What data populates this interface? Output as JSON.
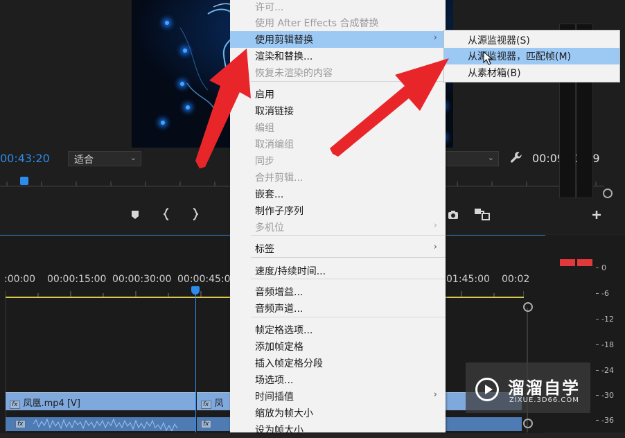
{
  "monitor": {
    "timecode_current": "00:43:20",
    "timecode_duration": "00:09:02:19",
    "fit_value": "适合",
    "playhead_position": 0.04
  },
  "timeline": {
    "ruler_labels": [
      ":00:00",
      "00:00:15:00",
      "00:00:30:00",
      "00:00:45:00",
      "01:45:00",
      "00:02"
    ],
    "clip_1_name": "凤凰.mp4 [V]",
    "clip_2_name": "凤",
    "fx_label": "fx"
  },
  "meters": {
    "db_labels": [
      "0",
      "-6",
      "-12",
      "-18",
      "-24",
      "-30",
      "-36"
    ]
  },
  "context_menu": {
    "items": [
      {
        "label": "许可...",
        "enabled": false,
        "submenu": false
      },
      {
        "label": "使用 After Effects 合成替换",
        "enabled": false,
        "submenu": false
      },
      {
        "label": "使用剪辑替换",
        "enabled": true,
        "submenu": true,
        "highlighted": true
      },
      {
        "label": "渲染和替换...",
        "enabled": true,
        "submenu": false
      },
      {
        "label": "恢复未渲染的内容",
        "enabled": false,
        "submenu": false
      },
      {
        "label": "启用",
        "enabled": true,
        "submenu": false
      },
      {
        "label": "取消链接",
        "enabled": true,
        "submenu": false
      },
      {
        "label": "编组",
        "enabled": false,
        "submenu": false
      },
      {
        "label": "取消编组",
        "enabled": false,
        "submenu": false
      },
      {
        "label": "同步",
        "enabled": false,
        "submenu": false
      },
      {
        "label": "合并剪辑...",
        "enabled": false,
        "submenu": false
      },
      {
        "label": "嵌套...",
        "enabled": true,
        "submenu": false
      },
      {
        "label": "制作子序列",
        "enabled": true,
        "submenu": false
      },
      {
        "label": "多机位",
        "enabled": false,
        "submenu": true
      },
      {
        "label": "标签",
        "enabled": true,
        "submenu": true
      },
      {
        "label": "速度/持续时间...",
        "enabled": true,
        "submenu": false
      },
      {
        "label": "音频增益...",
        "enabled": true,
        "submenu": false
      },
      {
        "label": "音频声道...",
        "enabled": true,
        "submenu": false
      },
      {
        "label": "帧定格选项...",
        "enabled": true,
        "submenu": false
      },
      {
        "label": "添加帧定格",
        "enabled": true,
        "submenu": false
      },
      {
        "label": "插入帧定格分段",
        "enabled": true,
        "submenu": false
      },
      {
        "label": "场选项...",
        "enabled": true,
        "submenu": false
      },
      {
        "label": "时间插值",
        "enabled": true,
        "submenu": true
      },
      {
        "label": "缩放为帧大小",
        "enabled": true,
        "submenu": false
      },
      {
        "label": "设为帧大小",
        "enabled": true,
        "submenu": false
      }
    ],
    "submenu_arrow": "›"
  },
  "submenu": {
    "items": [
      {
        "label": "从源监视器(S)",
        "highlighted": false
      },
      {
        "label": "从源监视器，匹配帧(M)",
        "highlighted": true
      },
      {
        "label": "从素材箱(B)",
        "highlighted": false
      }
    ]
  },
  "watermark": {
    "title": "溜溜自学",
    "subtitle": "ZIXUE.3D66.COM"
  },
  "colors": {
    "accent_blue": "#2d8ceb",
    "menu_highlight": "#9cc8f4",
    "clip_blue": "#7fa9dd",
    "arrow_red": "#e8262a",
    "meter_peak": "#e23a3a"
  }
}
